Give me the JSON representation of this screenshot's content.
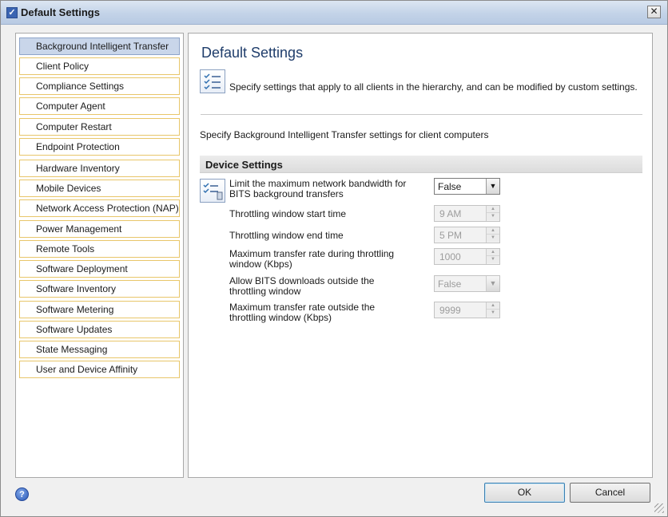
{
  "window": {
    "title": "Default Settings",
    "close_label": "✕"
  },
  "sidebar": {
    "items": [
      {
        "label": "Background Intelligent Transfer",
        "selected": true
      },
      {
        "label": "Client Policy"
      },
      {
        "label": "Compliance Settings"
      },
      {
        "label": "Computer Agent"
      },
      {
        "label": "Computer Restart"
      },
      {
        "label": "Endpoint Protection"
      },
      {
        "label": "Hardware Inventory"
      },
      {
        "label": "Mobile Devices"
      },
      {
        "label": "Network Access Protection (NAP)"
      },
      {
        "label": "Power Management"
      },
      {
        "label": "Remote Tools"
      },
      {
        "label": "Software Deployment"
      },
      {
        "label": "Software Inventory"
      },
      {
        "label": "Software Metering"
      },
      {
        "label": "Software Updates"
      },
      {
        "label": "State Messaging"
      },
      {
        "label": "User and Device Affinity"
      }
    ]
  },
  "main": {
    "heading": "Default Settings",
    "description": "Specify settings that apply to all clients in the hierarchy, and can be modified by custom settings.",
    "specify_text": "Specify Background Intelligent Transfer settings for client computers",
    "section_title": "Device Settings",
    "settings": [
      {
        "label": "Limit the maximum network bandwidth for BITS background transfers",
        "value": "False",
        "control": "dropdown",
        "enabled": true
      },
      {
        "label": "Throttling window start time",
        "value": "9 AM",
        "control": "spinner",
        "enabled": false
      },
      {
        "label": "Throttling window end time",
        "value": "5 PM",
        "control": "spinner",
        "enabled": false
      },
      {
        "label": "Maximum transfer rate during throttling window (Kbps)",
        "value": "1000",
        "control": "spinner",
        "enabled": false
      },
      {
        "label": "Allow BITS downloads outside the throttling window",
        "value": "False",
        "control": "dropdown",
        "enabled": false
      },
      {
        "label": "Maximum transfer rate outside the throttling window (Kbps)",
        "value": "9999",
        "control": "spinner",
        "enabled": false
      }
    ]
  },
  "footer": {
    "ok_label": "OK",
    "cancel_label": "Cancel",
    "help_icon": "help-icon"
  },
  "colors": {
    "selected_nav": "#c9d6ea",
    "nav_border": "#e8c66a",
    "heading": "#1f3d6b",
    "ok_border": "#3c7fb1"
  }
}
